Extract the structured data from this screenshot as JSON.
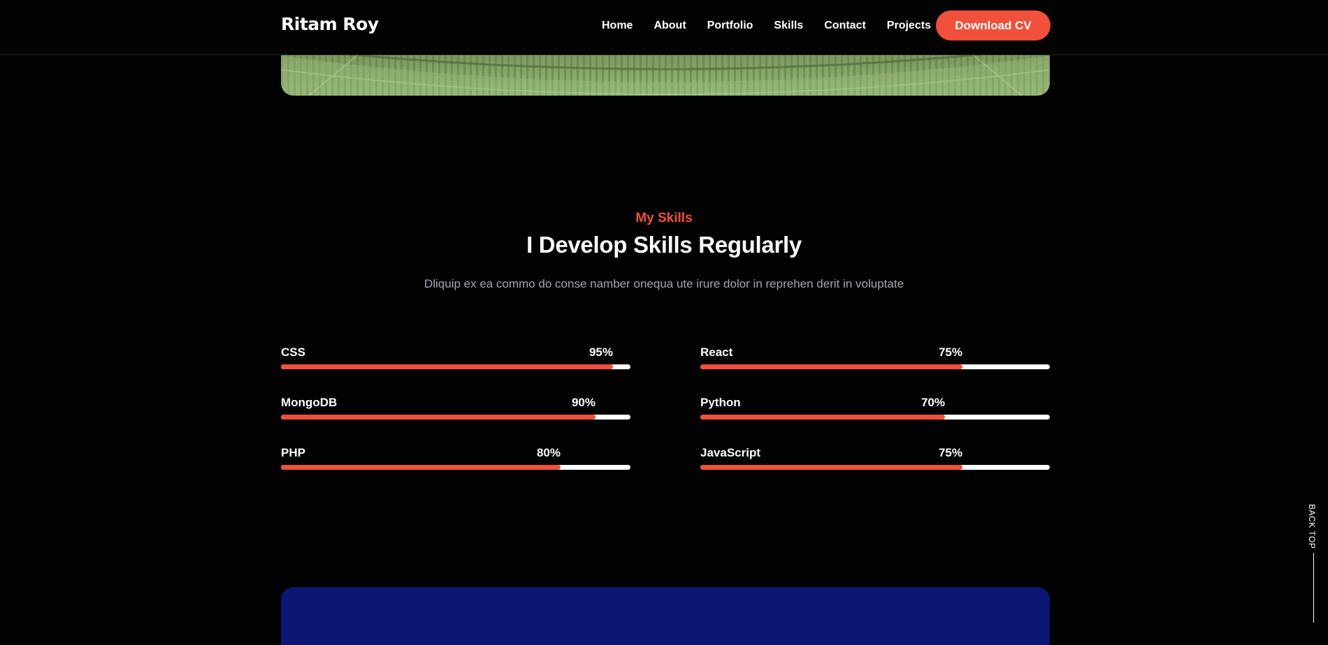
{
  "header": {
    "brand": "Ritam Roy",
    "nav": [
      {
        "label": "Home"
      },
      {
        "label": "About"
      },
      {
        "label": "Portfolio"
      },
      {
        "label": "Skills"
      },
      {
        "label": "Contact"
      },
      {
        "label": "Projects"
      }
    ],
    "cta_label": "Download CV"
  },
  "skills_section": {
    "eyebrow": "My Skills",
    "title": "I Develop Skills Regularly",
    "description": "Dliquip ex ea commo do conse namber onequa ute irure dolor in reprehen derit in voluptate",
    "skills": [
      {
        "name": "CSS",
        "percent_label": "95%",
        "value": 0.95
      },
      {
        "name": "React",
        "percent_label": "75%",
        "value": 0.75
      },
      {
        "name": "MongoDB",
        "percent_label": "90%",
        "value": 0.9
      },
      {
        "name": "Python",
        "percent_label": "70%",
        "value": 0.7
      },
      {
        "name": "PHP",
        "percent_label": "80%",
        "value": 0.8
      },
      {
        "name": "JavaScript",
        "percent_label": "75%",
        "value": 0.75
      }
    ]
  },
  "back_top": {
    "label": "BACK TOP"
  },
  "colors": {
    "accent": "#f1503a",
    "background": "#020202",
    "card_blue": "#0b1873",
    "track": "#ffffff"
  }
}
